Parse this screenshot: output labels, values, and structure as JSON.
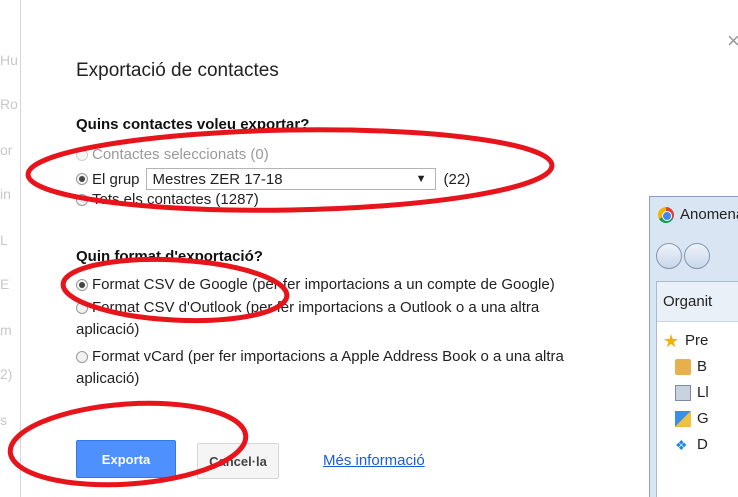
{
  "background": {
    "left_letters": [
      "Hu",
      "Ro",
      "or",
      "in",
      "L",
      "E",
      "m",
      "2)",
      "s"
    ]
  },
  "dialog": {
    "close_glyph": "×",
    "title": "Exportació de contactes",
    "which_contacts": {
      "heading": "Quins contactes voleu exportar?",
      "option_selected": "Contactes seleccionats (0)",
      "option_group_label": "El grup",
      "group_select_value": "Mestres ZER 17-18",
      "group_count": "(22)",
      "option_all": "Tots els contactes (1287)"
    },
    "export_format": {
      "heading": "Quin format d'exportació?",
      "option_google_csv": "Format CSV de Google (per fer importacions a un compte de Google)",
      "option_outlook_csv_line1": "Format CSV d'Outlook (per fer importacions a Outlook o a una altra",
      "option_outlook_csv_line2": "aplicació)",
      "option_vcard_line1": "Format vCard (per fer importacions a Apple Address Book o a una altra",
      "option_vcard_line2": "aplicació)"
    },
    "buttons": {
      "export": "Exporta",
      "cancel": "Cancel·la",
      "more_info": "Més informació"
    }
  },
  "explorer_window": {
    "title": "Anomena",
    "organize": "Organit",
    "items": [
      "Pre",
      "B",
      "Ll",
      "G",
      "D"
    ]
  },
  "colors": {
    "primary_button": "#4d90fe",
    "link": "#1a5cd8",
    "annotation": "#e8141c"
  }
}
